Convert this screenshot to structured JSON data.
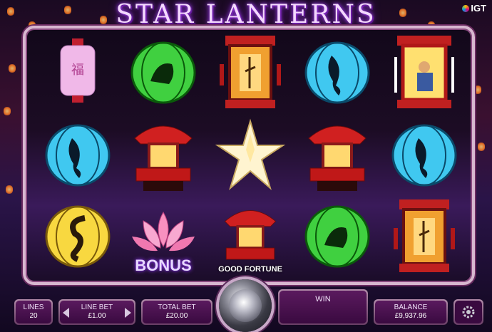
{
  "header": {
    "title": "STAR LANTERNS",
    "brand": "IGT"
  },
  "reels": {
    "rows": [
      [
        "pink-lantern",
        "green-tiger-lantern",
        "red-pagoda-lantern",
        "blue-koi-lantern",
        "red-scholar-lantern"
      ],
      [
        "blue-koi-lantern",
        "red-temple-lantern",
        "star-wild",
        "red-temple-lantern",
        "blue-koi-lantern"
      ],
      [
        "yellow-dragon-lantern",
        "lotus-bonus",
        "good-fortune-lantern",
        "green-tiger-lantern",
        "red-pagoda-lantern"
      ]
    ],
    "bonus_label": "BONUS",
    "good_fortune_label": "GOOD FORTUNE"
  },
  "controls": {
    "lines_label": "LINES",
    "lines_value": "20",
    "line_bet_label": "LINE BET",
    "line_bet_value": "£1.00",
    "total_bet_label": "TOTAL BET",
    "total_bet_value": "£20.00",
    "win_label": "WIN",
    "win_value": "",
    "balance_label": "BALANCE",
    "balance_value": "£9,937.96"
  },
  "colors": {
    "accent": "#b04cff",
    "panel": "#5a1a5e"
  }
}
